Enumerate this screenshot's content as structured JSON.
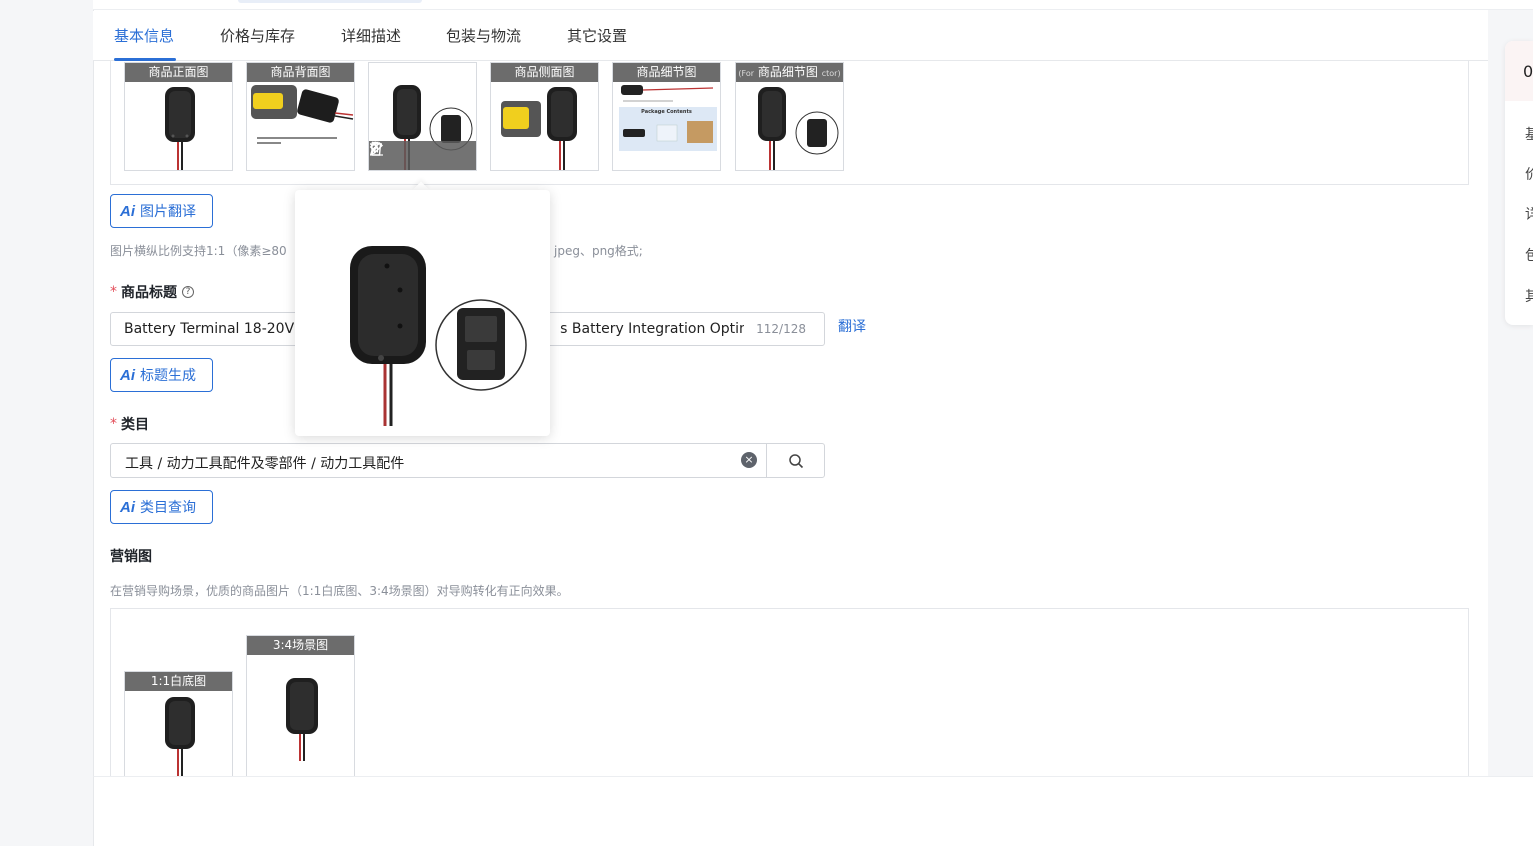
{
  "tabs": [
    {
      "label": "基本信息",
      "active": true
    },
    {
      "label": "价格与库存",
      "active": false
    },
    {
      "label": "详细描述",
      "active": false
    },
    {
      "label": "包装与物流",
      "active": false
    },
    {
      "label": "其它设置",
      "active": false
    }
  ],
  "main_images": {
    "labels": [
      "商品正面图",
      "商品背面图",
      "",
      "商品侧面图",
      "商品细节图",
      "商品细节图"
    ],
    "last_label_prefix": "(For",
    "last_label_suffix": "ctor)",
    "detail_caption": "Package Contents",
    "toolbar_icons": [
      "chevron-left-icon",
      "edit-icon",
      "trash-icon",
      "chevron-right-icon"
    ]
  },
  "ai_image_translate": {
    "mark": "Ai",
    "label": "图片翻译"
  },
  "image_hint_left": "图片横纵比例支持1:1（像素≥80",
  "image_hint_right": "jpeg、png格式;",
  "product_title": {
    "label": "商品标题",
    "help": "?",
    "value_left": "Battery Terminal 18-20V A",
    "value_right": "s Battery Integration Optimiz",
    "count": "112/128",
    "translate": "翻译"
  },
  "ai_title_generate": {
    "mark": "Ai",
    "label": "标题生成"
  },
  "category": {
    "label": "类目",
    "value": "工具 / 动力工具配件及零部件 / 动力工具配件",
    "clear": "×"
  },
  "ai_category_query": {
    "mark": "Ai",
    "label": "类目查询"
  },
  "marketing": {
    "title": "营销图",
    "hint": "在营销导购场景，优质的商品图片（1:1白底图、3:4场景图）对导购转化有正向效果。",
    "thumbs": [
      "1:1白底图",
      "3:4场景图"
    ]
  },
  "right_panel": {
    "number": "0",
    "items": [
      "基",
      "价",
      "详",
      "包",
      "其"
    ]
  },
  "colors": {
    "accent": "#2b6fd6",
    "required": "#e34d59",
    "label_bg": "#606060"
  }
}
